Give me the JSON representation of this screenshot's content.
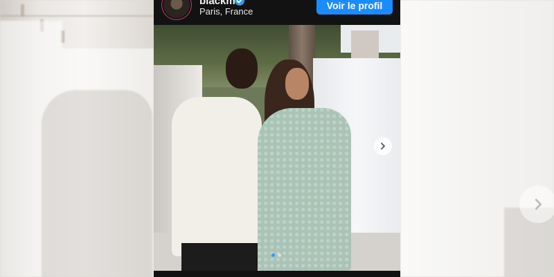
{
  "post": {
    "username": "blackm",
    "location": "Paris, France",
    "profile_button": "Voir le profil",
    "carousel": {
      "slide_count": 2,
      "active_index": 0
    }
  },
  "icons": {
    "verified": "verified-badge-icon",
    "next": "chevron-right-icon",
    "background_next": "chevron-right-icon"
  },
  "colors": {
    "accent": "#1a8cff",
    "verified": "#3897f0",
    "card_background": "#111111"
  }
}
